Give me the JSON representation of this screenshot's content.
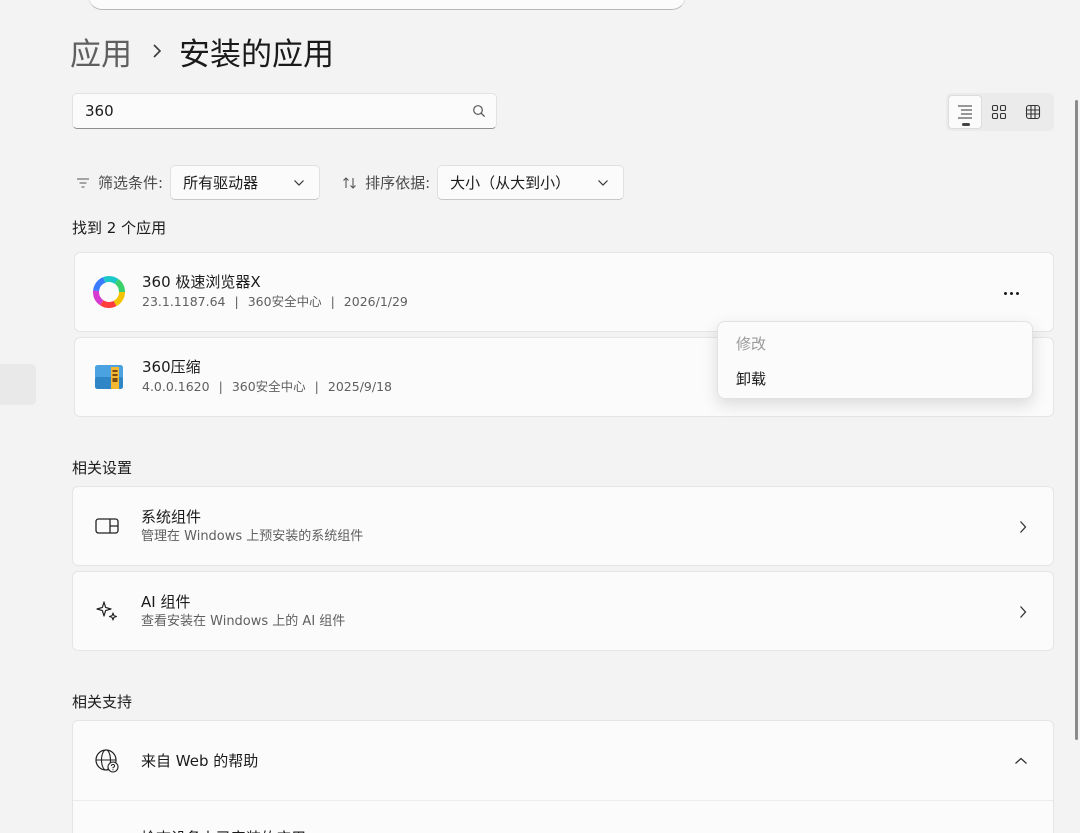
{
  "breadcrumb": {
    "parent": "应用",
    "current": "安装的应用"
  },
  "search": {
    "value": "360"
  },
  "filter": {
    "filter_label": "筛选条件:",
    "drive_value": "所有驱动器",
    "sort_label": "排序依据:",
    "sort_value": "大小（从大到小）"
  },
  "results": {
    "count_label": "找到 2 个应用",
    "apps": [
      {
        "name": "360 极速浏览器X",
        "version": "23.1.1187.64",
        "publisher": "360安全中心",
        "date": "2026/1/29",
        "icon": "browser-icon"
      },
      {
        "name": "360压缩",
        "version": "4.0.0.1620",
        "publisher": "360安全中心",
        "date": "2025/9/18",
        "icon": "archive-icon"
      }
    ]
  },
  "context_menu": {
    "items": [
      {
        "label": "修改",
        "enabled": false
      },
      {
        "label": "卸载",
        "enabled": true
      }
    ]
  },
  "related_settings": {
    "title": "相关设置",
    "items": [
      {
        "title": "系统组件",
        "desc": "管理在 Windows 上预安装的系统组件",
        "icon": "component-icon"
      },
      {
        "title": "AI 组件",
        "desc": "查看安装在 Windows 上的 AI 组件",
        "icon": "sparkle-icon"
      }
    ]
  },
  "related_support": {
    "title": "相关支持",
    "help_title": "来自 Web 的帮助",
    "help_item": "检查设备上已安装的应用"
  }
}
